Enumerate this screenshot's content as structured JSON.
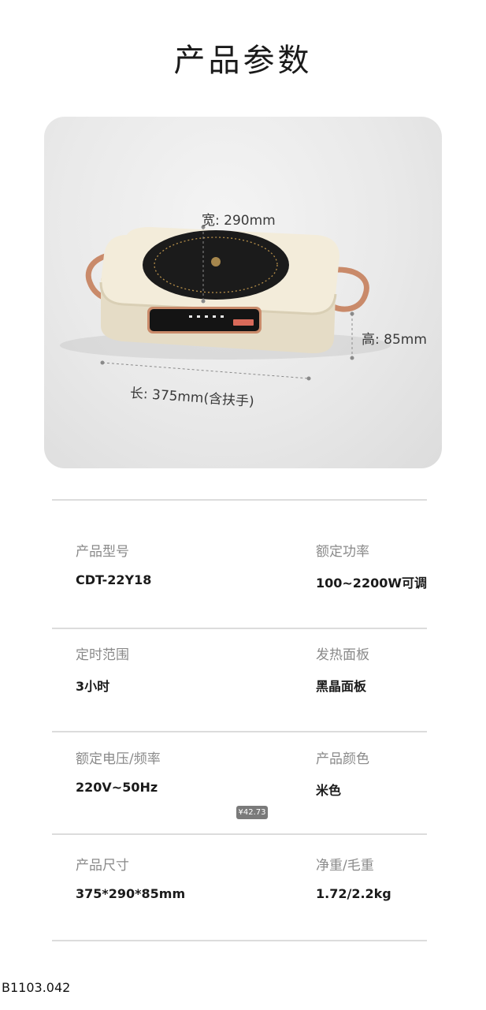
{
  "page": {
    "title": "产品参数"
  },
  "hero": {
    "width_label": "宽: 290mm",
    "height_label": "高: 85mm",
    "length_label": "长: 375mm(含扶手)"
  },
  "specs": [
    {
      "left_label": "产品型号",
      "left_value": "CDT-22Y18",
      "right_label": "额定功率",
      "right_value": "100~2200W可调"
    },
    {
      "left_label": "定时范围",
      "left_value": "3小时",
      "right_label": "发热面板",
      "right_value": "黑晶面板"
    },
    {
      "left_label": "额定电压/频率",
      "left_value": "220V~50Hz",
      "right_label": "产品颜色",
      "right_value": "米色"
    },
    {
      "left_label": "产品尺寸",
      "left_value": "375*290*85mm",
      "right_label": "净重/毛重",
      "right_value": "1.72/2.2kg"
    }
  ],
  "price_tag": "¥42.73",
  "product_code": "B1103.042",
  "colors": {
    "body": "#f1ead8",
    "handle": "#c98a6a",
    "cooktop": "#1b1b1b"
  }
}
